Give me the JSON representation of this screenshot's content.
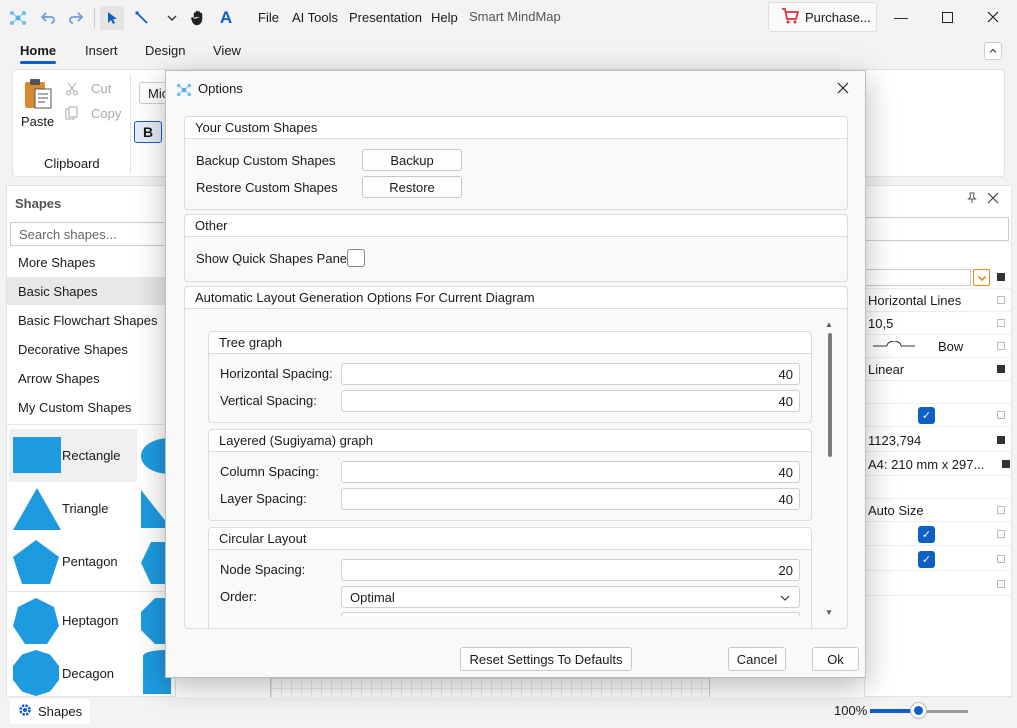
{
  "titlebar": {
    "menu": [
      "File",
      "AI Tools",
      "Presentation",
      "Help"
    ],
    "app_title": "Smart MindMap",
    "purchase_label": "Purchase...",
    "icons": [
      "app-logo-icon",
      "undo-icon",
      "redo-icon",
      "pointer-icon",
      "connector-icon",
      "chevron-down-icon",
      "hand-icon",
      "text-icon",
      "cart-icon"
    ]
  },
  "ribbon": {
    "tabs": [
      "Home",
      "Insert",
      "Design",
      "View"
    ],
    "paste_label": "Paste",
    "cut_label": "Cut",
    "copy_label": "Copy",
    "group_label": "Clipboard",
    "font_partial": "Mic",
    "bold_label": "B"
  },
  "shapes_panel": {
    "title": "Shapes",
    "search_placeholder": "Search shapes...",
    "categories": [
      "More Shapes",
      "Basic Shapes",
      "Basic Flowchart Shapes",
      "Decorative Shapes",
      "Arrow Shapes",
      "My Custom Shapes"
    ],
    "selected_category": "Basic Shapes",
    "tiles": [
      "Rectangle",
      "Triangle",
      "Pentagon",
      "Heptagon",
      "Decagon"
    ],
    "shape_color": "#1e9be0"
  },
  "props_panel": {
    "rows": [
      "",
      "Horizontal Lines",
      "10,5",
      "Bow",
      "Linear",
      "",
      "",
      "1123,794",
      "A4:  210 mm x 297...",
      "",
      "Auto Size",
      "",
      "",
      ""
    ]
  },
  "dialog": {
    "title": "Options",
    "custom_shapes": {
      "header": "Your Custom Shapes",
      "backup_label": "Backup Custom Shapes",
      "backup_button": "Backup",
      "restore_label": "Restore Custom Shapes",
      "restore_button": "Restore"
    },
    "other": {
      "header": "Other",
      "quick_shapes_label": "Show Quick Shapes Panel"
    },
    "layout": {
      "header": "Automatic Layout Generation Options For Current Diagram",
      "tree": {
        "header": "Tree graph",
        "h_label": "Horizontal Spacing:",
        "h_value": "40",
        "v_label": "Vertical Spacing:",
        "v_value": "40"
      },
      "layered": {
        "header": "Layered (Sugiyama) graph",
        "col_label": "Column Spacing:",
        "col_value": "40",
        "layer_label": "Layer Spacing:",
        "layer_value": "40"
      },
      "circular": {
        "header": "Circular Layout",
        "node_label": "Node Spacing:",
        "node_value": "20",
        "order_label": "Order:",
        "order_value": "Optimal"
      }
    },
    "reset_button": "Reset Settings To Defaults",
    "cancel_button": "Cancel",
    "ok_button": "Ok"
  },
  "statusbar": {
    "shapes_tab": "Shapes",
    "zoom": "100%"
  },
  "colors": {
    "accent": "#0f5fc4",
    "shape_fill": "#1e9be0"
  }
}
